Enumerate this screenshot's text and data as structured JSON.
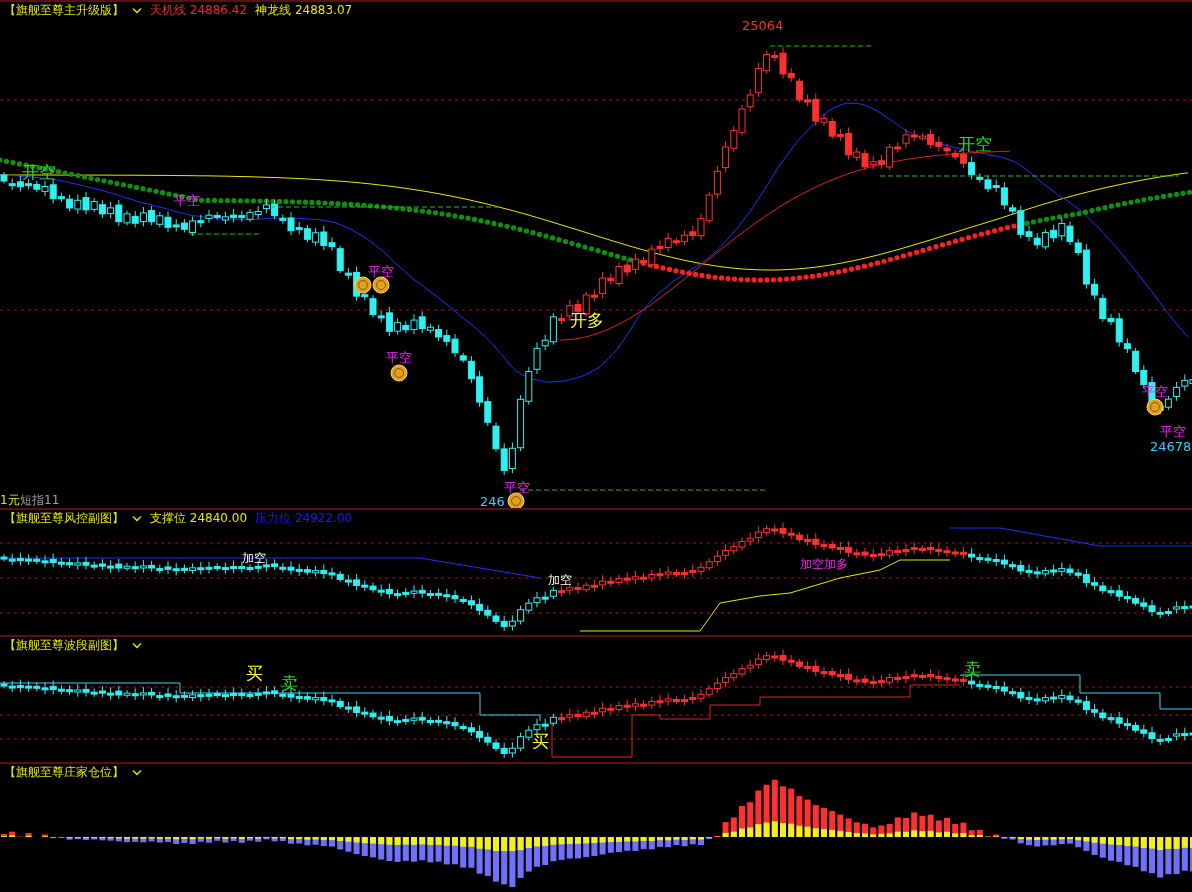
{
  "main_panel": {
    "title": "【旗舰至尊主升级版】",
    "indicators": [
      {
        "name": "天机线",
        "value": "24886.42",
        "color": "#ff2020"
      },
      {
        "name": "神龙线",
        "value": "24883.07",
        "color": "#e8e800"
      }
    ],
    "signals": [
      {
        "kind": "open_short",
        "text": "开空"
      },
      {
        "kind": "close_short",
        "text": "平空"
      },
      {
        "kind": "close_short",
        "text": "平空"
      },
      {
        "kind": "close_short",
        "text": "平空"
      },
      {
        "kind": "close_short",
        "text": "平空"
      },
      {
        "kind": "open_long",
        "text": "开多"
      },
      {
        "kind": "open_short",
        "text": "开空"
      },
      {
        "kind": "close_short",
        "text": "平空"
      },
      {
        "kind": "close_short",
        "text": "平空"
      }
    ],
    "price_labels": [
      {
        "kind": "high",
        "text": "25064"
      },
      {
        "kind": "low",
        "text": "246"
      },
      {
        "kind": "low",
        "text": "24678"
      }
    ],
    "footer": [
      "1元",
      "短指11"
    ]
  },
  "risk_panel": {
    "title": "【旗舰至尊风控副图】",
    "indicators": [
      {
        "name": "支撑位",
        "value": "24840.00",
        "color": "#e8e800"
      },
      {
        "name": "压力位",
        "value": "24922.00",
        "color": "#1a1aff"
      }
    ],
    "signals": [
      {
        "kind": "add",
        "text": "加空"
      },
      {
        "kind": "add",
        "text": "加空"
      },
      {
        "kind": "add_mixed",
        "text": "加空加多"
      }
    ]
  },
  "wave_panel": {
    "title": "【旗舰至尊波段副图】",
    "signals": [
      {
        "kind": "buy",
        "text": "买"
      },
      {
        "kind": "sell",
        "text": "卖"
      },
      {
        "kind": "buy",
        "text": "买"
      },
      {
        "kind": "sell",
        "text": "卖"
      }
    ]
  },
  "position_panel": {
    "title": "【旗舰至尊庄家仓位】"
  }
}
